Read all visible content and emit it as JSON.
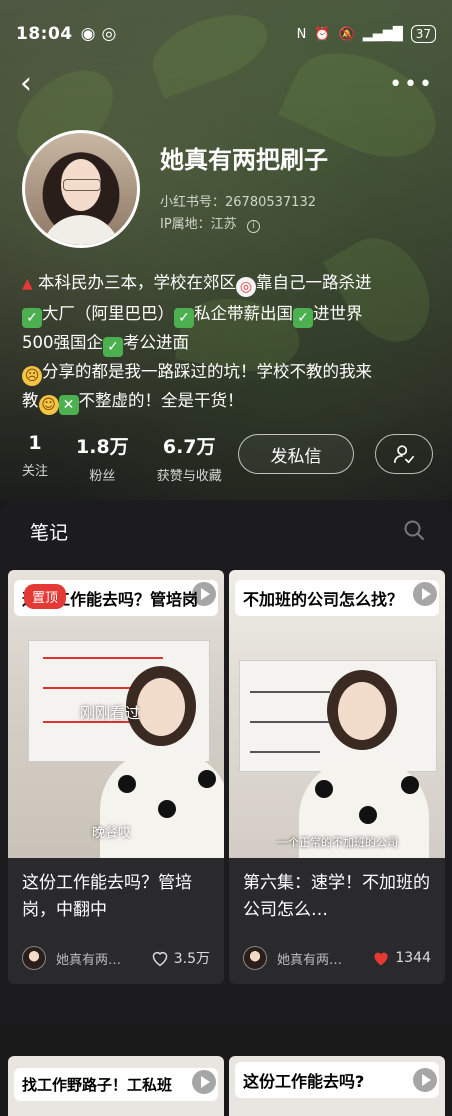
{
  "status": {
    "time": "18:04",
    "battery": "37"
  },
  "profile": {
    "name": "她真有两把刷子",
    "id_line": "小红书号：26780537132",
    "ip_line": "IP属地：江苏",
    "bio_line1": "本科民办三本，学校在郊区",
    "bio_line1b": "靠自己一路杀进",
    "bio_line2a": "大厂（阿里巴巴）",
    "bio_line2b": "私企带薪出国",
    "bio_line2c": "进世界",
    "bio_line3a": "500强国企",
    "bio_line3b": "考公进面",
    "bio_line4": "分享的都是我一路踩过的坑！学校不教的我来",
    "bio_line5a": "教",
    "bio_line5b": "不整虚的！全是干货！"
  },
  "stats": [
    {
      "num": "1",
      "label": "关注"
    },
    {
      "num": "1.8万",
      "label": "粉丝"
    },
    {
      "num": "6.7万",
      "label": "获赞与收藏"
    }
  ],
  "buttons": {
    "message": "发私信"
  },
  "tabs": {
    "notes": "笔记"
  },
  "cards": [
    {
      "cover_title": "这份工作能去吗？管培岗",
      "badge": "置顶",
      "overlay": "刚刚看过",
      "overlay2": "晚餐哎",
      "caption": "这份工作能去吗？管培岗，中翻中",
      "author": "她真有两…",
      "likes": "3.5万",
      "liked": false
    },
    {
      "cover_title": "不加班的公司怎么找？",
      "overlay_sub": "一个正常的不加班的公司",
      "caption": "第六集：速学！不加班的公司怎么…",
      "author": "她真有两…",
      "likes": "1344",
      "liked": true
    }
  ],
  "bottom_cards": [
    {
      "title": "找工作野路子！工私班"
    },
    {
      "title": "这份工作能去吗?"
    }
  ],
  "colors": {
    "accent_red": "#e53935",
    "check_green": "#4caf50"
  }
}
